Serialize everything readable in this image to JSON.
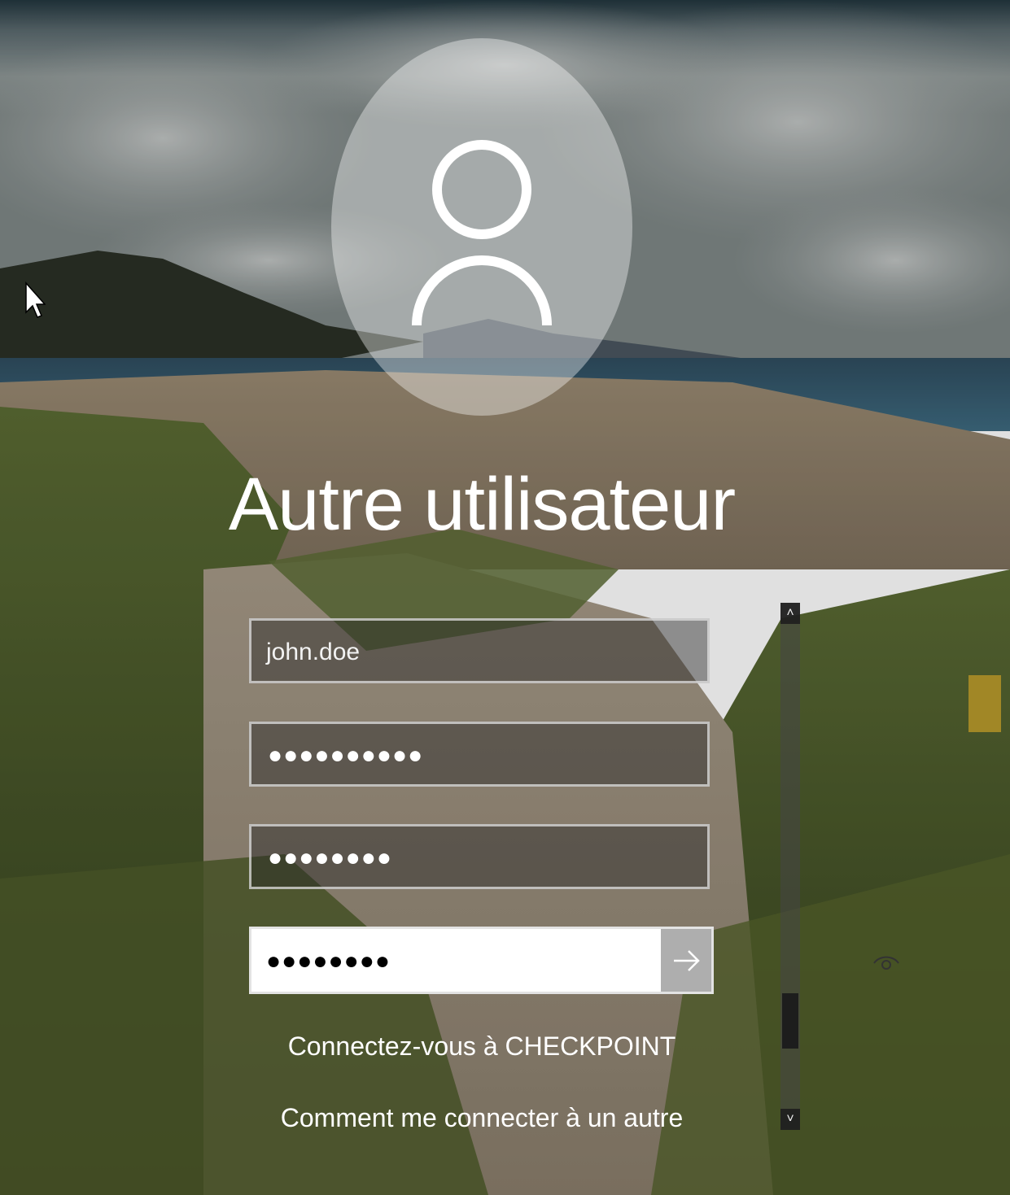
{
  "user": {
    "display_name": "Autre utilisateur",
    "avatar_icon": "user-icon"
  },
  "form": {
    "username_value": "john.doe",
    "field2_masked": "●●●●●●●●●●",
    "field3_masked": "●●●●●●●●",
    "field4_masked": "●●●●●●●●",
    "reveal_icon": "eye-icon",
    "submit_icon": "arrow-right-icon"
  },
  "links": {
    "connect_to": "Connectez-vous à CHECKPOINT",
    "how_to_connect": "Comment me connecter à un autre"
  },
  "scrollbar": {
    "up_glyph": "˄",
    "down_glyph": "˅",
    "scroll_position": 0.86
  },
  "colors": {
    "text": "#ffffff",
    "field_border": "#e1e1e1",
    "active_field_bg": "#ffffff"
  }
}
